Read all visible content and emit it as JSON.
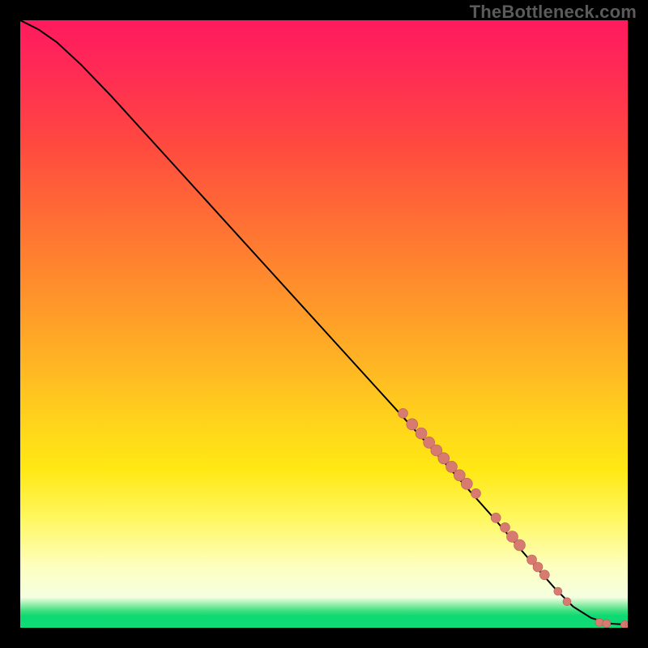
{
  "watermark": "TheBottleneck.com",
  "colors": {
    "background": "#000000",
    "gradient_top": "#ff1a5e",
    "gradient_mid": "#ffd31c",
    "gradient_bottom": "#0fdb77",
    "curve_stroke": "#000000",
    "dot_fill": "#d77a70",
    "dot_stroke": "#b85f56"
  },
  "chart_data": {
    "type": "line",
    "title": "",
    "xlabel": "",
    "ylabel": "",
    "xlim": [
      0,
      100
    ],
    "ylim": [
      0,
      100
    ],
    "grid": false,
    "legend": false,
    "curve": {
      "comment": "Monotone decreasing bottleneck-style curve; x runs left→right 0..100, y bottom→top 0..100",
      "points": [
        {
          "x": 0,
          "y": 100
        },
        {
          "x": 3,
          "y": 98.5
        },
        {
          "x": 6,
          "y": 96.4
        },
        {
          "x": 10,
          "y": 92.7
        },
        {
          "x": 15,
          "y": 87.5
        },
        {
          "x": 20,
          "y": 82.0
        },
        {
          "x": 30,
          "y": 71.0
        },
        {
          "x": 40,
          "y": 60.0
        },
        {
          "x": 50,
          "y": 49.0
        },
        {
          "x": 60,
          "y": 38.0
        },
        {
          "x": 70,
          "y": 27.0
        },
        {
          "x": 78,
          "y": 18.0
        },
        {
          "x": 84,
          "y": 11.0
        },
        {
          "x": 88,
          "y": 6.5
        },
        {
          "x": 91,
          "y": 3.5
        },
        {
          "x": 94,
          "y": 1.6
        },
        {
          "x": 97,
          "y": 0.7
        },
        {
          "x": 100,
          "y": 0.5
        }
      ]
    },
    "highlight_dots": {
      "comment": "Salmon dots overlaid along the near-linear tail section of the curve, values in same 0..100 space, r is visual radius in px at 750px plot",
      "points": [
        {
          "x": 63.0,
          "y": 35.3,
          "r": 6
        },
        {
          "x": 64.5,
          "y": 33.5,
          "r": 7
        },
        {
          "x": 66.0,
          "y": 32.0,
          "r": 7
        },
        {
          "x": 67.3,
          "y": 30.5,
          "r": 7
        },
        {
          "x": 68.5,
          "y": 29.2,
          "r": 7
        },
        {
          "x": 69.7,
          "y": 27.9,
          "r": 7
        },
        {
          "x": 71.0,
          "y": 26.5,
          "r": 7
        },
        {
          "x": 72.3,
          "y": 25.1,
          "r": 7
        },
        {
          "x": 73.5,
          "y": 23.7,
          "r": 7
        },
        {
          "x": 75.0,
          "y": 22.1,
          "r": 6
        },
        {
          "x": 78.3,
          "y": 18.1,
          "r": 6
        },
        {
          "x": 79.8,
          "y": 16.5,
          "r": 6
        },
        {
          "x": 81.0,
          "y": 15.0,
          "r": 7
        },
        {
          "x": 82.2,
          "y": 13.6,
          "r": 7
        },
        {
          "x": 84.2,
          "y": 11.2,
          "r": 6
        },
        {
          "x": 85.2,
          "y": 10.0,
          "r": 6
        },
        {
          "x": 86.3,
          "y": 8.7,
          "r": 6
        },
        {
          "x": 88.5,
          "y": 6.0,
          "r": 5
        },
        {
          "x": 90.0,
          "y": 4.3,
          "r": 5
        },
        {
          "x": 95.3,
          "y": 0.9,
          "r": 5
        },
        {
          "x": 96.5,
          "y": 0.7,
          "r": 5
        },
        {
          "x": 99.5,
          "y": 0.5,
          "r": 5
        },
        {
          "x": 100.3,
          "y": 0.5,
          "r": 5
        }
      ]
    }
  }
}
